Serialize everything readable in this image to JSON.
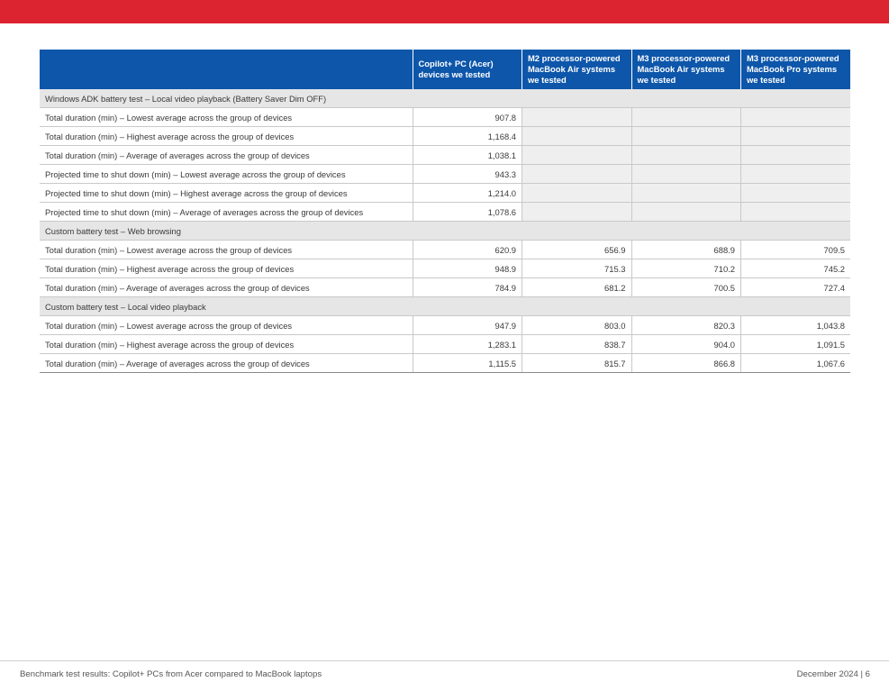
{
  "colors": {
    "accent_red": "#dc2430",
    "header_blue": "#0d56aa",
    "section_gray": "#e6e6e6",
    "empty_cell_gray": "#efefef"
  },
  "table": {
    "headers": [
      "",
      "Copilot+ PC (Acer) devices we tested",
      "M2 processor-powered MacBook Air systems we tested",
      "M3 processor-powered MacBook Air systems we tested",
      "M3 processor-powered MacBook Pro systems we tested"
    ],
    "sections": [
      {
        "title": "Windows ADK battery test – Local video playback (Battery Saver Dim OFF)",
        "rows": [
          {
            "label": "Total duration (min) – Lowest average across the group of devices",
            "values": [
              "907.8",
              "",
              "",
              ""
            ]
          },
          {
            "label": "Total duration (min) – Highest average across the group of devices",
            "values": [
              "1,168.4",
              "",
              "",
              ""
            ]
          },
          {
            "label": "Total duration (min) – Average of averages across the group of devices",
            "values": [
              "1,038.1",
              "",
              "",
              ""
            ]
          },
          {
            "label": "Projected time to shut down (min) – Lowest average across the group of devices",
            "values": [
              "943.3",
              "",
              "",
              ""
            ]
          },
          {
            "label": "Projected time to shut down (min) – Highest average across the group of devices",
            "values": [
              "1,214.0",
              "",
              "",
              ""
            ]
          },
          {
            "label": "Projected time to shut down (min) – Average of averages across the group of devices",
            "values": [
              "1,078.6",
              "",
              "",
              ""
            ]
          }
        ]
      },
      {
        "title": "Custom battery test – Web browsing",
        "rows": [
          {
            "label": "Total duration (min) – Lowest average across the group of devices",
            "values": [
              "620.9",
              "656.9",
              "688.9",
              "709.5"
            ]
          },
          {
            "label": "Total duration (min) – Highest average across the group of devices",
            "values": [
              "948.9",
              "715.3",
              "710.2",
              "745.2"
            ]
          },
          {
            "label": "Total duration (min) – Average of averages across the group of devices",
            "values": [
              "784.9",
              "681.2",
              "700.5",
              "727.4"
            ]
          }
        ]
      },
      {
        "title": "Custom battery test – Local video playback",
        "rows": [
          {
            "label": "Total duration (min) – Lowest average across the group of devices",
            "values": [
              "947.9",
              "803.0",
              "820.3",
              "1,043.8"
            ]
          },
          {
            "label": "Total duration (min) – Highest average across the group of devices",
            "values": [
              "1,283.1",
              "838.7",
              "904.0",
              "1,091.5"
            ]
          },
          {
            "label": "Total duration (min) – Average of averages across the group of devices",
            "values": [
              "1,115.5",
              "815.7",
              "866.8",
              "1,067.6"
            ]
          }
        ]
      }
    ]
  },
  "footer": {
    "left": "Benchmark test results: Copilot+ PCs from Acer compared to MacBook laptops",
    "right": "December 2024 | 6"
  }
}
